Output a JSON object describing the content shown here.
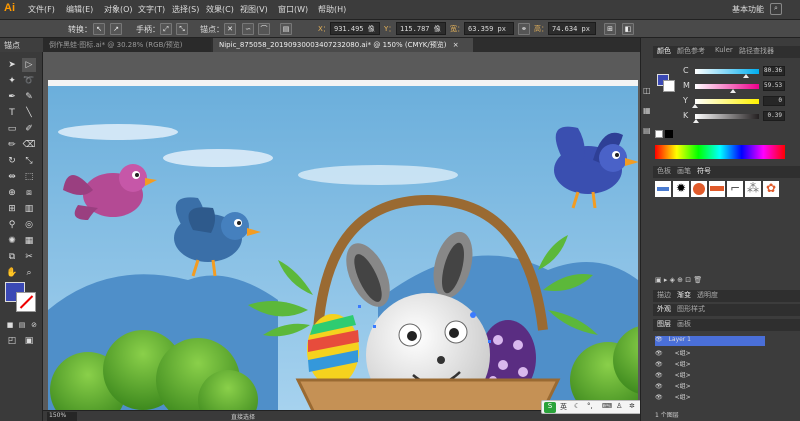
{
  "app": {
    "logo": "Ai"
  },
  "menu": {
    "items": [
      "文件(F)",
      "编辑(E)",
      "对象(O)",
      "文字(T)",
      "选择(S)",
      "效果(C)",
      "视图(V)",
      "窗口(W)",
      "帮助(H)"
    ],
    "workspace": "基本功能"
  },
  "control_bar": {
    "tool_name": "锚点",
    "convert_label": "转换：",
    "handle_label": "手柄：",
    "anchor_label": "锚点：",
    "x_label": "X：",
    "x_value": "931.495 像",
    "y_label": "Y：",
    "y_value": "115.787 像",
    "w_label": "宽：",
    "w_value": "63.359 px",
    "h_label": "高：",
    "h_value": "74.634 px"
  },
  "documents": {
    "tabs": [
      {
        "label": "倒作黑蛙·图标.ai* @ 30.28% (RGB/预览)",
        "active": false
      },
      {
        "label": "Nipic_875058_20190930003407232080.ai* @ 150% (CMYK/预览)",
        "active": true
      }
    ]
  },
  "status": {
    "zoom": "150%",
    "tool": "直接选择"
  },
  "panels": {
    "color_tabs": [
      "颜色",
      "颜色参考",
      "Kuler",
      "路径查找器"
    ],
    "color": {
      "sliders": [
        {
          "label": "C",
          "value": "80.36",
          "fraction": 0.8,
          "from": "#ffffff",
          "to": "#00aeef"
        },
        {
          "label": "M",
          "value": "59.53",
          "fraction": 0.6,
          "from": "#ffffff",
          "to": "#ec008c"
        },
        {
          "label": "Y",
          "value": "0",
          "fraction": 0.0,
          "from": "#ffffff",
          "to": "#fff200"
        },
        {
          "label": "K",
          "value": "0.39",
          "fraction": 0.01,
          "from": "#ffffff",
          "to": "#231f20"
        }
      ]
    },
    "swatch_tabs": [
      "色板",
      "画笔",
      "符号"
    ],
    "stroke_tabs": [
      "描边",
      "渐变",
      "透明度"
    ],
    "appearance_tabs": [
      "外观",
      "图形样式"
    ],
    "layer_tabs": [
      "图层",
      "画板"
    ],
    "layers": [
      {
        "name": "Layer 1",
        "color": "#4f6bff"
      },
      {
        "name": "<组>",
        "color": "#4f6bff"
      },
      {
        "name": "<组>",
        "color": "#4f6bff"
      },
      {
        "name": "<组>",
        "color": "#4f6bff"
      },
      {
        "name": "<组>",
        "color": "#4f6bff"
      },
      {
        "name": "<组>",
        "color": "#4f6bff"
      }
    ],
    "layer_count": "1 个图层"
  },
  "ime": {
    "logo": "S",
    "lang": "英"
  }
}
